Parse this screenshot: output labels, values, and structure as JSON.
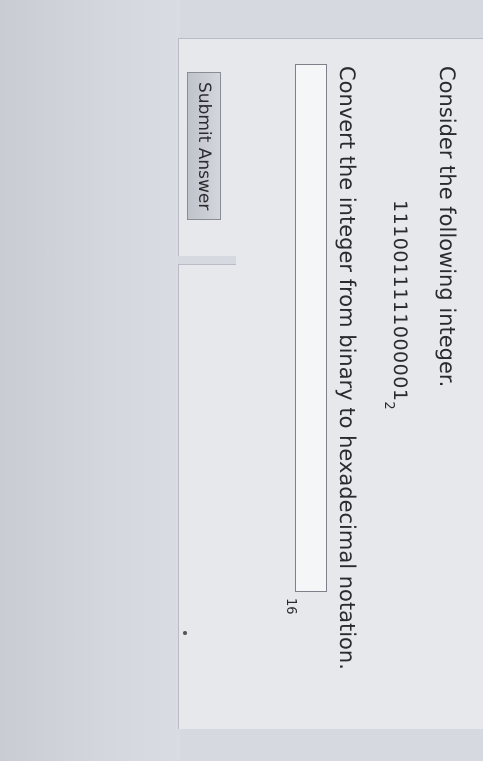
{
  "question": {
    "intro": "Consider the following integer.",
    "binary_value": "1110011111000001",
    "binary_base": "2",
    "instruction": "Convert the integer from binary to hexadecimal notation."
  },
  "answer": {
    "value": "",
    "placeholder": "",
    "base_label": "16"
  },
  "buttons": {
    "submit_label": "Submit Answer"
  }
}
